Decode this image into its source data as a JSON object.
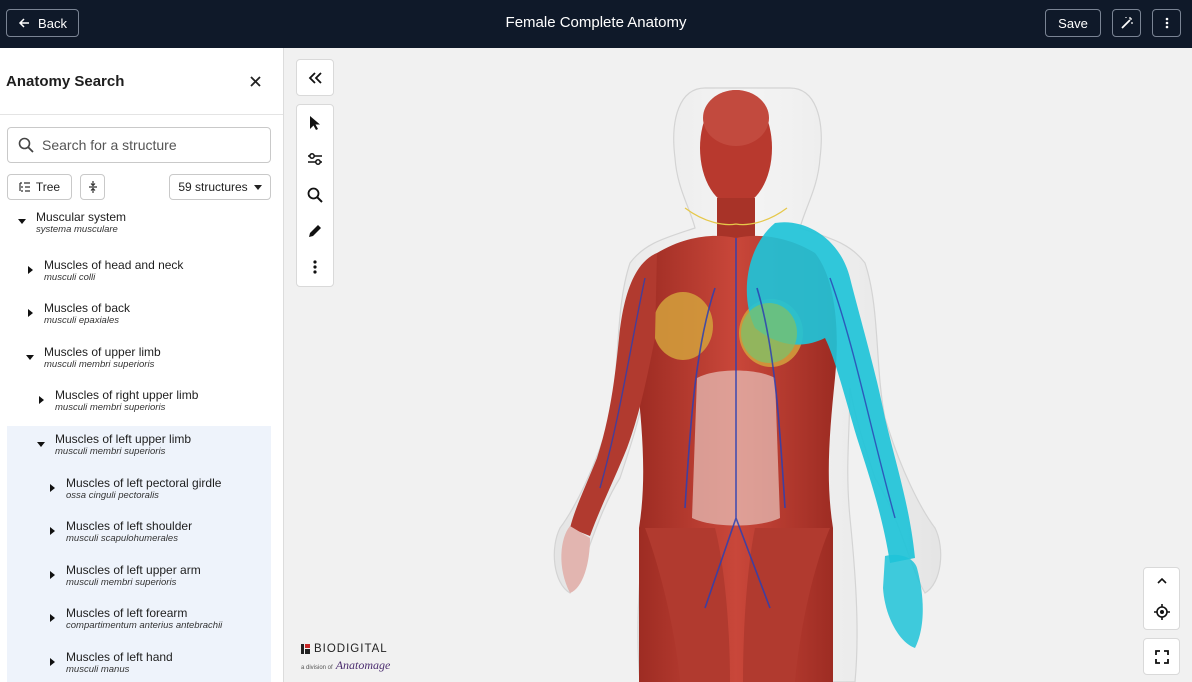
{
  "header": {
    "back_label": "Back",
    "title": "Female Complete Anatomy",
    "save_label": "Save"
  },
  "sidebar": {
    "title": "Anatomy Search",
    "search_placeholder": "Search for a structure",
    "tree_label": "Tree",
    "structures_label": "59 structures",
    "items": [
      {
        "name": "Muscular system",
        "latin": "systema musculare",
        "level": 0,
        "expanded": true,
        "highlighted": false
      },
      {
        "name": "Muscles of head and neck",
        "latin": "musculi colli",
        "level": 1,
        "expanded": false,
        "highlighted": false
      },
      {
        "name": "Muscles of back",
        "latin": "musculi epaxiales",
        "level": 1,
        "expanded": false,
        "highlighted": false
      },
      {
        "name": "Muscles of upper limb",
        "latin": "musculi membri superioris",
        "level": 1,
        "expanded": true,
        "highlighted": false
      },
      {
        "name": "Muscles of right upper limb",
        "latin": "musculi membri superioris",
        "level": 2,
        "expanded": false,
        "highlighted": false
      },
      {
        "name": "Muscles of left upper limb",
        "latin": "musculi membri superioris",
        "level": 2,
        "expanded": true,
        "highlighted": true
      },
      {
        "name": "Muscles of left pectoral girdle",
        "latin": "ossa cinguli pectoralis",
        "level": 3,
        "expanded": false,
        "highlighted": true
      },
      {
        "name": "Muscles of left shoulder",
        "latin": "musculi scapulohumerales",
        "level": 3,
        "expanded": false,
        "highlighted": true
      },
      {
        "name": "Muscles of left upper arm",
        "latin": "musculi membri superioris",
        "level": 3,
        "expanded": false,
        "highlighted": true
      },
      {
        "name": "Muscles of left forearm",
        "latin": "compartimentum anterius antebrachii",
        "level": 3,
        "expanded": false,
        "highlighted": true
      },
      {
        "name": "Muscles of left hand",
        "latin": "musculi manus",
        "level": 3,
        "expanded": false,
        "highlighted": true
      }
    ]
  },
  "viewer": {
    "logo_name": "BIODIGITAL",
    "logo_division": "a division of",
    "logo_parent": "Anatomage",
    "highlight_color": "#1fc3d8"
  }
}
